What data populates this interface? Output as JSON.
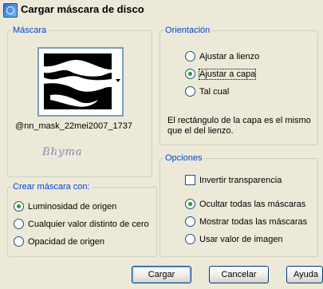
{
  "window": {
    "title": "Cargar máscara de disco"
  },
  "mascara": {
    "legend": "Máscara",
    "selected_mask": "@nn_mask_22mei2007_1737",
    "watermark": "Bhyma"
  },
  "crear": {
    "legend": "Crear máscara con:",
    "options": [
      {
        "label": "Luminosidad de origen",
        "checked": true
      },
      {
        "label": "Cualquier valor distinto de cero",
        "checked": false
      },
      {
        "label": "Opacidad de origen",
        "checked": false
      }
    ]
  },
  "orientacion": {
    "legend": "Orientación",
    "options": [
      {
        "label": "Ajustar a lienzo",
        "checked": false
      },
      {
        "label": "Ajustar a capa",
        "checked": true
      },
      {
        "label": "Tal cual",
        "checked": false
      }
    ],
    "description": "El rectángulo de la capa es el mismo que el del lienzo."
  },
  "opciones": {
    "legend": "Opciones",
    "invert_label": "Invertir transparencia",
    "invert_checked": false,
    "options": [
      {
        "label": "Ocultar todas las máscaras",
        "checked": true
      },
      {
        "label": "Mostrar todas las máscaras",
        "checked": false
      },
      {
        "label": "Usar valor de imagen",
        "checked": false
      }
    ]
  },
  "buttons": {
    "load": "Cargar",
    "cancel": "Cancelar",
    "help": "Ayuda"
  }
}
